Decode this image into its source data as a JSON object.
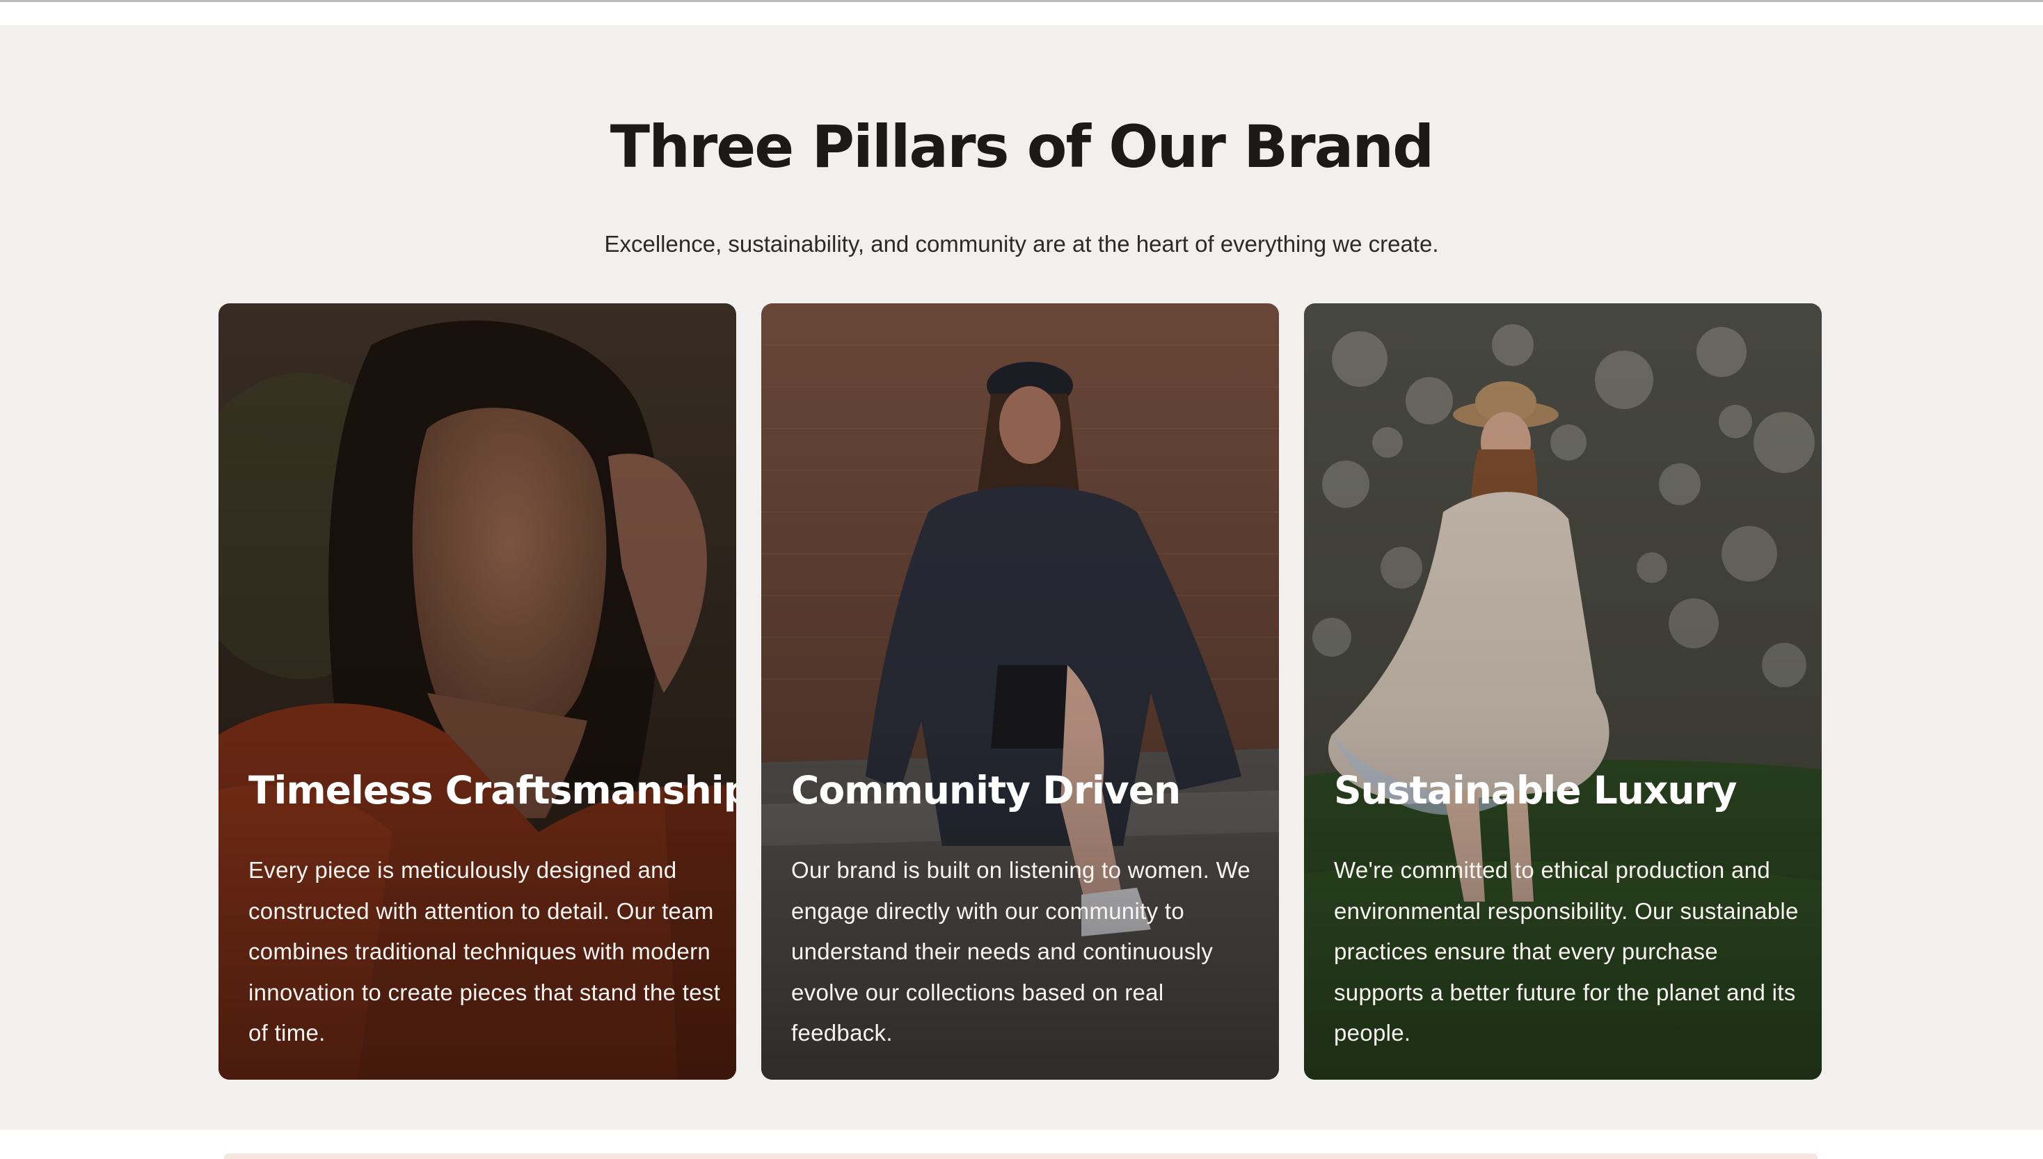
{
  "section": {
    "title": "Three Pillars of Our Brand",
    "subtitle": "Excellence, sustainability, and community are at the heart of everything we create."
  },
  "cards": [
    {
      "title": "Timeless Craftsmanship",
      "body": "Every piece is meticulously designed and constructed with attention to detail. Our team combines traditional techniques with modern innovation to create pieces that stand the test of time."
    },
    {
      "title": "Community Driven",
      "body": "Our brand is built on listening to women. We engage directly with our community to understand their needs and continuously evolve our collections based on real feedback."
    },
    {
      "title": "Sustainable Luxury",
      "body": "We're committed to ethical production and environmental responsibility. Our sustainable practices ensure that every purchase supports a better future for the planet and its people."
    }
  ],
  "colors": {
    "section_background": "#f2f0ef",
    "heading": "#1c1a19",
    "card_text": "#ffffff"
  }
}
